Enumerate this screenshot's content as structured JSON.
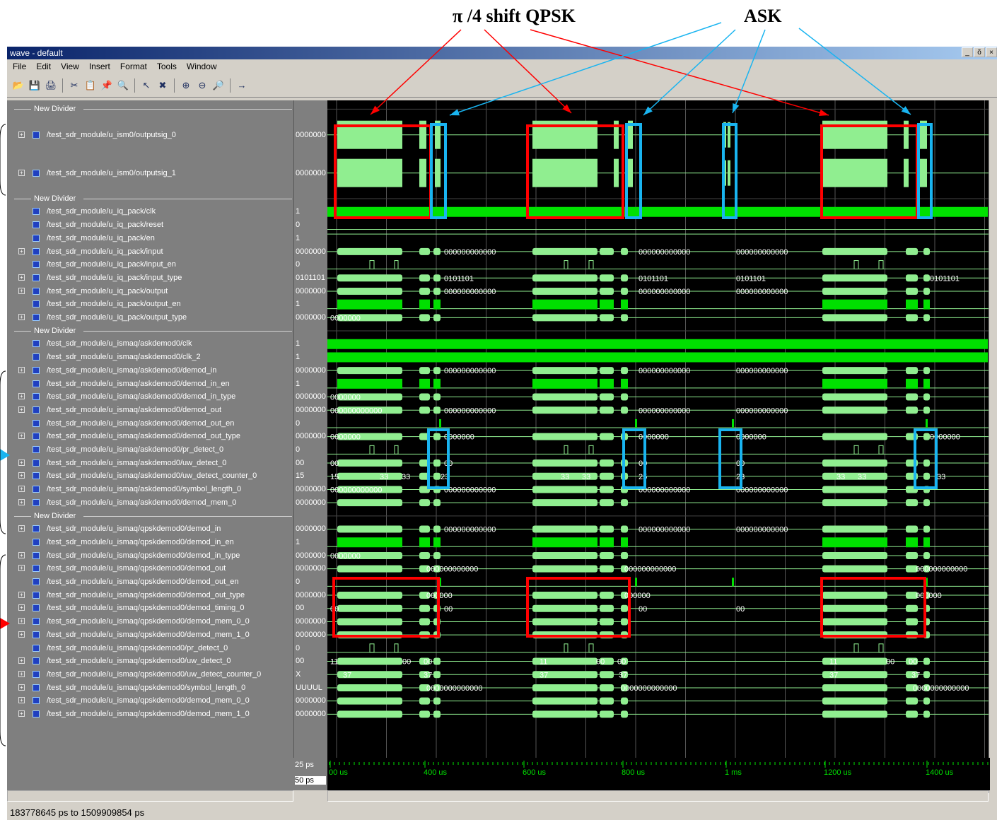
{
  "annotations": {
    "qpsk_label": "π /4 shift QPSK",
    "ask_label": "ASK"
  },
  "window": {
    "title": "wave - default",
    "controls": [
      "_",
      "õ",
      "×"
    ]
  },
  "menu": [
    "File",
    "Edit",
    "View",
    "Insert",
    "Format",
    "Tools",
    "Window"
  ],
  "toolbar_icons": [
    "open-icon",
    "save-icon",
    "print-icon",
    "cut-icon",
    "copy-icon",
    "paste-icon",
    "find-icon",
    "select-icon",
    "delete-icon",
    "zoom-in-icon",
    "zoom-out-icon",
    "zoom-full-icon",
    "cursor-icon"
  ],
  "rows": [
    {
      "type": "divider",
      "label": "New Divider"
    },
    {
      "type": "signal",
      "expand": true,
      "name": "/test_sdr_module/u_ism0/outputsig_0",
      "value": "0000000",
      "tall": true
    },
    {
      "type": "signal",
      "expand": true,
      "name": "/test_sdr_module/u_ism0/outputsig_1",
      "value": "0000000",
      "tall": true
    },
    {
      "type": "divider",
      "label": "New Divider"
    },
    {
      "type": "signal",
      "expand": false,
      "name": "/test_sdr_module/u_iq_pack/clk",
      "value": "1"
    },
    {
      "type": "signal",
      "expand": false,
      "name": "/test_sdr_module/u_iq_pack/reset",
      "value": "0"
    },
    {
      "type": "signal",
      "expand": false,
      "name": "/test_sdr_module/u_iq_pack/en",
      "value": "1"
    },
    {
      "type": "signal",
      "expand": true,
      "name": "/test_sdr_module/u_iq_pack/input",
      "value": "0000000"
    },
    {
      "type": "signal",
      "expand": false,
      "name": "/test_sdr_module/u_iq_pack/input_en",
      "value": "0"
    },
    {
      "type": "signal",
      "expand": true,
      "name": "/test_sdr_module/u_iq_pack/input_type",
      "value": "0101101"
    },
    {
      "type": "signal",
      "expand": true,
      "name": "/test_sdr_module/u_iq_pack/output",
      "value": "0000000"
    },
    {
      "type": "signal",
      "expand": false,
      "name": "/test_sdr_module/u_iq_pack/output_en",
      "value": "1"
    },
    {
      "type": "signal",
      "expand": true,
      "name": "/test_sdr_module/u_iq_pack/output_type",
      "value": "0000000"
    },
    {
      "type": "divider",
      "label": "New Divider"
    },
    {
      "type": "signal",
      "expand": false,
      "name": "/test_sdr_module/u_ismaq/askdemod0/clk",
      "value": "1"
    },
    {
      "type": "signal",
      "expand": false,
      "name": "/test_sdr_module/u_ismaq/askdemod0/clk_2",
      "value": "1"
    },
    {
      "type": "signal",
      "expand": true,
      "name": "/test_sdr_module/u_ismaq/askdemod0/demod_in",
      "value": "0000000"
    },
    {
      "type": "signal",
      "expand": false,
      "name": "/test_sdr_module/u_ismaq/askdemod0/demod_in_en",
      "value": "1"
    },
    {
      "type": "signal",
      "expand": true,
      "name": "/test_sdr_module/u_ismaq/askdemod0/demod_in_type",
      "value": "0000000"
    },
    {
      "type": "signal",
      "expand": true,
      "name": "/test_sdr_module/u_ismaq/askdemod0/demod_out",
      "value": "0000000"
    },
    {
      "type": "signal",
      "expand": false,
      "name": "/test_sdr_module/u_ismaq/askdemod0/demod_out_en",
      "value": "0"
    },
    {
      "type": "signal",
      "expand": true,
      "name": "/test_sdr_module/u_ismaq/askdemod0/demod_out_type",
      "value": "0000000"
    },
    {
      "type": "signal",
      "expand": false,
      "name": "/test_sdr_module/u_ismaq/askdemod0/pr_detect_0",
      "value": "0"
    },
    {
      "type": "signal",
      "expand": true,
      "name": "/test_sdr_module/u_ismaq/askdemod0/uw_detect_0",
      "value": "00"
    },
    {
      "type": "signal",
      "expand": true,
      "name": "/test_sdr_module/u_ismaq/askdemod0/uw_detect_counter_0",
      "value": "15"
    },
    {
      "type": "signal",
      "expand": true,
      "name": "/test_sdr_module/u_ismaq/askdemod0/symbol_length_0",
      "value": "0000000"
    },
    {
      "type": "signal",
      "expand": true,
      "name": "/test_sdr_module/u_ismaq/askdemod0/demod_mem_0",
      "value": "0000000"
    },
    {
      "type": "divider",
      "label": "New Divider"
    },
    {
      "type": "signal",
      "expand": true,
      "name": "/test_sdr_module/u_ismaq/qpskdemod0/demod_in",
      "value": "0000000"
    },
    {
      "type": "signal",
      "expand": false,
      "name": "/test_sdr_module/u_ismaq/qpskdemod0/demod_in_en",
      "value": "1"
    },
    {
      "type": "signal",
      "expand": true,
      "name": "/test_sdr_module/u_ismaq/qpskdemod0/demod_in_type",
      "value": "0000000"
    },
    {
      "type": "signal",
      "expand": true,
      "name": "/test_sdr_module/u_ismaq/qpskdemod0/demod_out",
      "value": "0000000"
    },
    {
      "type": "signal",
      "expand": false,
      "name": "/test_sdr_module/u_ismaq/qpskdemod0/demod_out_en",
      "value": "0"
    },
    {
      "type": "signal",
      "expand": true,
      "name": "/test_sdr_module/u_ismaq/qpskdemod0/demod_out_type",
      "value": "0000000"
    },
    {
      "type": "signal",
      "expand": true,
      "name": "/test_sdr_module/u_ismaq/qpskdemod0/demod_timing_0",
      "value": "00"
    },
    {
      "type": "signal",
      "expand": true,
      "name": "/test_sdr_module/u_ismaq/qpskdemod0/demod_mem_0_0",
      "value": "0000000"
    },
    {
      "type": "signal",
      "expand": true,
      "name": "/test_sdr_module/u_ismaq/qpskdemod0/demod_mem_1_0",
      "value": "0000000"
    },
    {
      "type": "signal",
      "expand": false,
      "name": "/test_sdr_module/u_ismaq/qpskdemod0/pr_detect_0",
      "value": "0"
    },
    {
      "type": "signal",
      "expand": true,
      "name": "/test_sdr_module/u_ismaq/qpskdemod0/uw_detect_0",
      "value": "00"
    },
    {
      "type": "signal",
      "expand": true,
      "name": "/test_sdr_module/u_ismaq/qpskdemod0/uw_detect_counter_0",
      "value": "X"
    },
    {
      "type": "signal",
      "expand": true,
      "name": "/test_sdr_module/u_ismaq/qpskdemod0/symbol_length_0",
      "value": "UUUUL"
    },
    {
      "type": "signal",
      "expand": true,
      "name": "/test_sdr_module/u_ismaq/qpskdemod0/demod_mem_0_0",
      "value": "0000000"
    },
    {
      "type": "signal",
      "expand": true,
      "name": "/test_sdr_module/u_ismaq/qpskdemod0/demod_mem_1_0",
      "value": "0000000"
    }
  ],
  "bus_labels": {
    "zeros12": "000000000000",
    "type_val": "0101101",
    "short0": "0000000",
    "c33": "33",
    "c23": "23",
    "c25": "25",
    "c15": "15",
    "c37": "37",
    "v00": "00",
    "v11": "11",
    "long0": "0000000000000",
    "qo": "000000000000",
    "qt": "000000"
  },
  "time_axis": {
    "ticks": [
      "00 us",
      "400 us",
      "600 us",
      "800 us",
      "1 ms",
      "1200 us",
      "1400 us"
    ],
    "cursor1": "25 ps",
    "cursor2": "50 ps"
  },
  "status": "183778645 ps to 1509909854 ps",
  "colors": {
    "wave": "#90ee90",
    "bright": "#00e000",
    "qpsk_box": "#ff0000",
    "ask_box": "#19b4f0",
    "bg": "#000000"
  }
}
